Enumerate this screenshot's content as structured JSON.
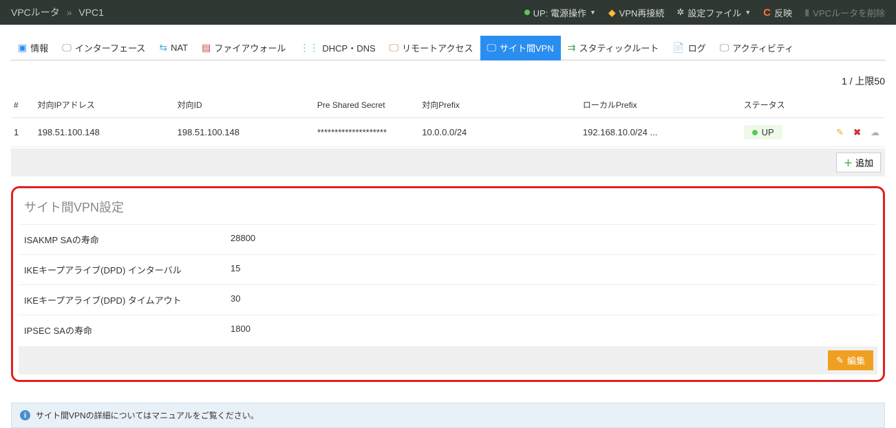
{
  "breadcrumb": {
    "root": "VPCルータ",
    "current": "VPC1"
  },
  "topActions": {
    "power": "UP: 電源操作",
    "vpnReconnect": "VPN再接続",
    "configFile": "設定ファイル",
    "apply": "反映",
    "delete": "VPCルータを削除"
  },
  "tabs": [
    {
      "label": "情報"
    },
    {
      "label": "インターフェース"
    },
    {
      "label": "NAT"
    },
    {
      "label": "ファイアウォール"
    },
    {
      "label": "DHCP・DNS"
    },
    {
      "label": "リモートアクセス"
    },
    {
      "label": "サイト間VPN"
    },
    {
      "label": "スタティックルート"
    },
    {
      "label": "ログ"
    },
    {
      "label": "アクティビティ"
    }
  ],
  "countLine": "1 / 上限50",
  "columns": {
    "num": "#",
    "peerIp": "対向IPアドレス",
    "peerId": "対向ID",
    "psk": "Pre Shared Secret",
    "peerPrefix": "対向Prefix",
    "localPrefix": "ローカルPrefix",
    "status": "ステータス"
  },
  "rows": [
    {
      "num": "1",
      "peerIp": "198.51.100.148",
      "peerId": "198.51.100.148",
      "psk": "********************",
      "peerPrefix": "10.0.0.0/24",
      "localPrefix": "192.168.10.0/24 ...",
      "status": "UP"
    }
  ],
  "addLabel": "追加",
  "vpnSettings": {
    "title": "サイト間VPN設定",
    "items": [
      {
        "label": "ISAKMP SAの寿命",
        "value": "28800"
      },
      {
        "label": "IKEキープアライブ(DPD) インターバル",
        "value": "15"
      },
      {
        "label": "IKEキープアライブ(DPD) タイムアウト",
        "value": "30"
      },
      {
        "label": "IPSEC SAの寿命",
        "value": "1800"
      }
    ],
    "editLabel": "編集"
  },
  "infoStrip": "サイト間VPNの詳細についてはマニュアルをご覧ください。"
}
